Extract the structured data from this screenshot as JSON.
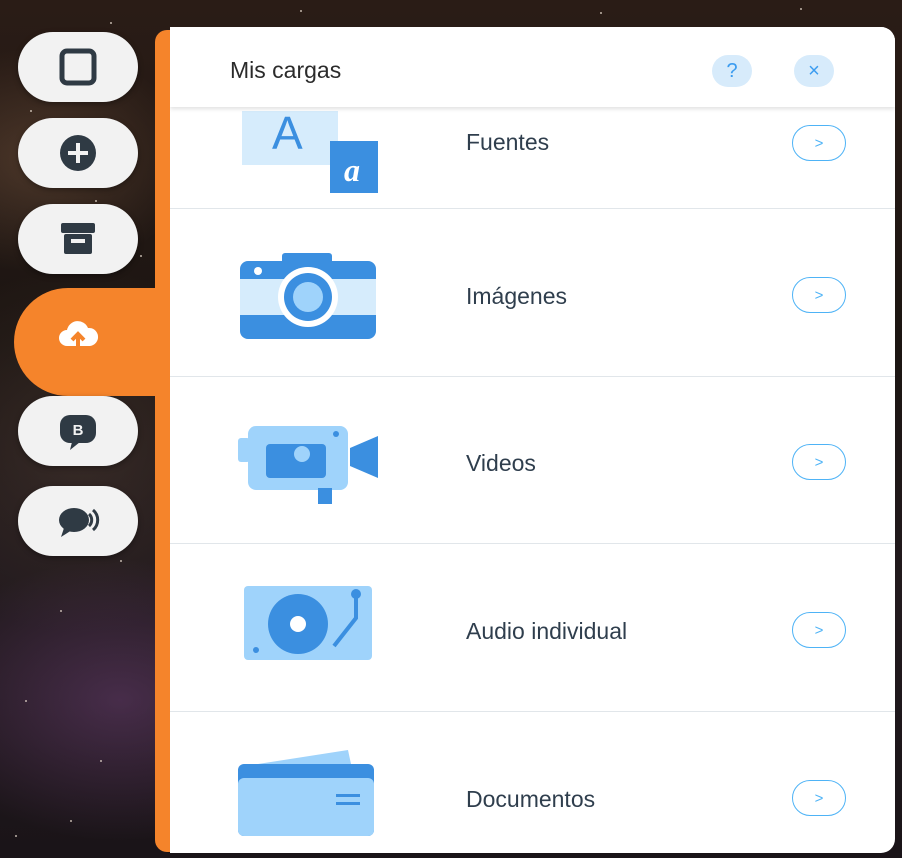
{
  "panel": {
    "title": "Mis cargas",
    "help_label": "?",
    "close_label": "×"
  },
  "rail": [
    {
      "icon": "square-icon"
    },
    {
      "icon": "add-icon"
    },
    {
      "icon": "store-icon"
    },
    {
      "icon": "upload-cloud-icon",
      "active": true
    },
    {
      "icon": "blog-icon",
      "badge": "B"
    },
    {
      "icon": "chat-icon"
    }
  ],
  "items": [
    {
      "label": "Fuentes",
      "icon": "fonts-icon",
      "glyph_a": "A",
      "glyph_b": "a"
    },
    {
      "label": "Imágenes",
      "icon": "camera-icon"
    },
    {
      "label": "Videos",
      "icon": "video-camera-icon"
    },
    {
      "label": "Audio individual",
      "icon": "turntable-icon"
    },
    {
      "label": "Documentos",
      "icon": "folder-icon"
    }
  ],
  "arrow_glyph": ">",
  "colors": {
    "accent": "#f5842b",
    "link": "#4eb3f6",
    "icon_dark": "#3b8fe0",
    "icon_light": "#9fd3fb"
  }
}
